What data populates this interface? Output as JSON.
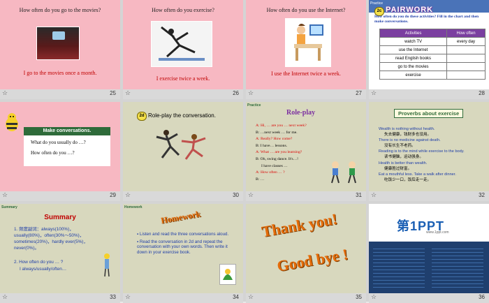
{
  "slides": [
    {
      "num": "25",
      "q": "How often do you go to the movies?",
      "a": "I go to the movies once a month."
    },
    {
      "num": "26",
      "q": "How often do you exercise?",
      "a": "I exercise twice a week."
    },
    {
      "num": "27",
      "q": "How often do you use the Internet?",
      "a": "I use the Internet twice a week."
    },
    {
      "num": "28",
      "practice": "Practice",
      "badge": "2c",
      "title": "PAIRWORK",
      "instr": "How often do you do these activities? Fill in the chart and then make conversations.",
      "table": {
        "headers": [
          "Activities",
          "How often"
        ],
        "rows": [
          [
            "watch TV",
            "every day"
          ],
          [
            "use the Internet",
            ""
          ],
          [
            "read English books",
            ""
          ],
          [
            "go to the movies",
            ""
          ],
          [
            "exercise",
            ""
          ]
        ]
      }
    },
    {
      "num": "29",
      "banner": "Make conversations.",
      "l1": "What do you usually do …?",
      "l2": "How often do you …?"
    },
    {
      "num": "30",
      "badge": "2d",
      "title": "Role-play the conversation."
    },
    {
      "num": "31",
      "practice": "Practice",
      "title": "Role-play",
      "lines": [
        "A: Hi, … are you … next week?",
        "B: …next week … for me.",
        "A: Really? How come?",
        "B: I have… lessons.",
        "A: What … are you learning?",
        "B: Oh, swing dance. It's…!",
        "I have classes …",
        "A: How often … ?",
        "B: …"
      ]
    },
    {
      "num": "32",
      "title": "Proverbs about exercise",
      "items": [
        {
          "en": "Wealth is nothing without health.",
          "cn": "失去健康，钱财多也没用。"
        },
        {
          "en": "There is no medicine against death.",
          "cn": "没有长生不老药。"
        },
        {
          "en": "Reading is to the mind while exercise to the body.",
          "cn": "读书健脑，运动强身。"
        },
        {
          "en": "Health is better than wealth.",
          "cn": "健康胜过财富。"
        },
        {
          "en": "Eat a mouthful less. Take a walk after dinner.",
          "cn": "吃饭少一口，饭后走一走。"
        }
      ]
    },
    {
      "num": "33",
      "label": "Summary",
      "title": "Summary",
      "p1": "1. 频度副词：always(100%)，usually(80%)，often(30%～50%)，sometimes(20%)，hardly ever(5%)，never(0%)。",
      "p2": "2. How often do you … ?",
      "p3": "I always/usually/often…"
    },
    {
      "num": "34",
      "label": "Homework",
      "title": "Homework",
      "b1": "Listen and read the three conversations aloud.",
      "b2": "Read the conversation in 2d and repeat the conversation with your own words. Then write it down in your exercise book."
    },
    {
      "num": "35",
      "t1": "Thank you!",
      "t2": "Good bye !"
    },
    {
      "num": "36",
      "logo": "第1PPT",
      "site": "www.1ppt.com"
    }
  ]
}
